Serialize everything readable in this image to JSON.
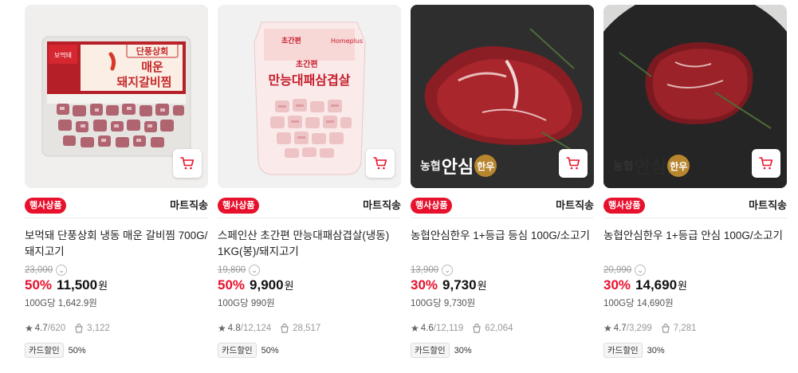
{
  "products": [
    {
      "badge": "행사상품",
      "shipping": "마트직송",
      "title": "보먹돼 단풍상회 냉동 매운 갈비찜 700G/돼지고기",
      "original_price": "23,000",
      "discount_rate": "50%",
      "price": "11,500",
      "won": "원",
      "unit_price": "100G당 1,642.9원",
      "rating": "4.7",
      "reviews": "620",
      "purchases": "3,122",
      "card_tag": "카드할인",
      "card_rate": "50%",
      "package_text_1": "단풍상회",
      "package_text_2": "매운",
      "package_text_3": "돼지갈비찜",
      "package_brand": "보먹돼",
      "icons": [
        "cart-icon",
        "info-icon",
        "star-icon",
        "purchase-icon"
      ]
    },
    {
      "badge": "행사상품",
      "shipping": "마트직송",
      "title": "스페인산 초간편 만능대패삼겹살(냉동) 1KG(봉)/돼지고기",
      "original_price": "19,800",
      "discount_rate": "50%",
      "price": "9,900",
      "won": "원",
      "unit_price": "100G당 990원",
      "rating": "4.8",
      "reviews": "12,124",
      "purchases": "28,517",
      "card_tag": "카드할인",
      "card_rate": "50%",
      "package_text_1": "초간편",
      "package_text_2": "만능대패삼겹살",
      "package_brand": "Homeplus",
      "icons": [
        "cart-icon",
        "info-icon",
        "star-icon",
        "purchase-icon"
      ]
    },
    {
      "badge": "행사상품",
      "shipping": "마트직송",
      "title": "농협안심한우 1+등급 등심 100G/소고기",
      "original_price": "13,900",
      "discount_rate": "30%",
      "price": "9,730",
      "won": "원",
      "unit_price": "100G당 9,730원",
      "rating": "4.6",
      "reviews": "12,119",
      "purchases": "62,064",
      "card_tag": "카드할인",
      "card_rate": "30%",
      "logo_a": "농협",
      "logo_b": "안심",
      "logo_c": "한우",
      "icons": [
        "cart-icon",
        "info-icon",
        "star-icon",
        "purchase-icon"
      ]
    },
    {
      "badge": "행사상품",
      "shipping": "마트직송",
      "title": "농협안심한우 1+등급 안심 100G/소고기",
      "original_price": "20,990",
      "discount_rate": "30%",
      "price": "14,690",
      "won": "원",
      "unit_price": "100G당 14,690원",
      "rating": "4.7",
      "reviews": "3,299",
      "purchases": "7,281",
      "card_tag": "카드할인",
      "card_rate": "30%",
      "logo_a": "농협",
      "logo_b": "안심",
      "logo_c": "한우",
      "icons": [
        "cart-icon",
        "info-icon",
        "star-icon",
        "purchase-icon"
      ]
    }
  ],
  "colors": {
    "accent_red": "#e8112d",
    "text_dark": "#222222",
    "text_muted": "#999999"
  }
}
